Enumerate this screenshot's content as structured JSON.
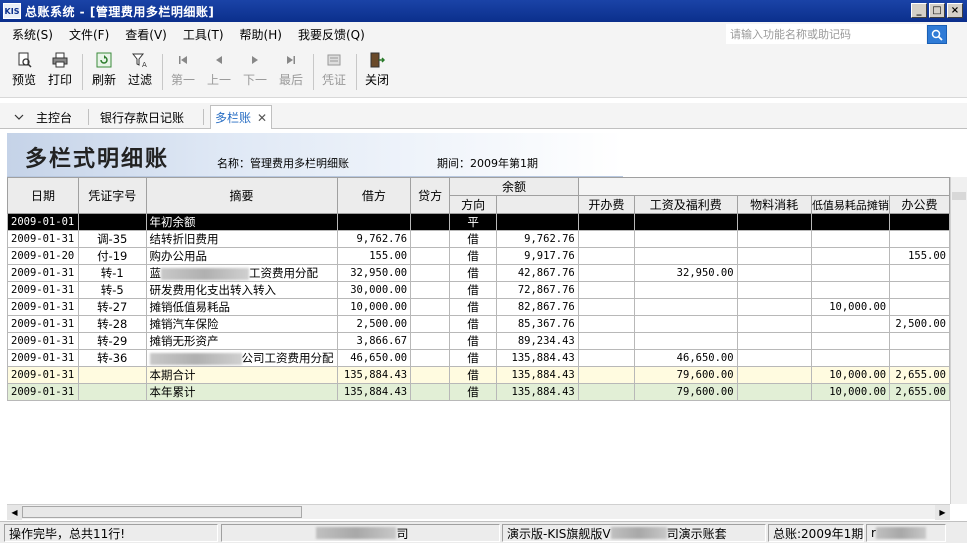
{
  "window": {
    "logo": "KIS",
    "title": "总账系统 - [管理费用多栏明细账]"
  },
  "menu": {
    "items": [
      "系统(S)",
      "文件(F)",
      "查看(V)",
      "工具(T)",
      "帮助(H)",
      "我要反馈(Q)"
    ],
    "search_placeholder": "请输入功能名称或助记码"
  },
  "toolbar": {
    "preview": "预览",
    "print": "打印",
    "refresh": "刷新",
    "filter": "过滤",
    "first": "第一",
    "prev": "上一",
    "next": "下一",
    "last": "最后",
    "voucher": "凭证",
    "close": "关闭"
  },
  "tabs": [
    {
      "label": "主控台"
    },
    {
      "label": "银行存款日记账"
    },
    {
      "label": "多栏账"
    }
  ],
  "report": {
    "title": "多栏式明细账",
    "name": "名称：管理费用多栏明细账",
    "period": "期间：2009年第1期"
  },
  "grid": {
    "headers": {
      "date": "日期",
      "voucher": "凭证字号",
      "summary": "摘要",
      "debit": "借方",
      "credit": "贷方",
      "balance": "余额",
      "direction": "方向",
      "amount": "",
      "c1": "开办费",
      "c2": "工资及福利费",
      "c3": "物料消耗",
      "c4": "低值易耗品摊销",
      "c5": "办公费"
    },
    "rows": [
      {
        "date": "2009-01-01",
        "voucher": "",
        "summary": "年初余额",
        "debit": "",
        "credit": "",
        "dir": "平",
        "bal": "",
        "c1": "",
        "c2": "",
        "c3": "",
        "c4": "",
        "c5": ""
      },
      {
        "date": "2009-01-31",
        "voucher": "调-35",
        "summary": "结转折旧费用",
        "debit": "9,762.76",
        "credit": "",
        "dir": "借",
        "bal": "9,762.76",
        "c1": "",
        "c2": "",
        "c3": "",
        "c4": "",
        "c5": ""
      },
      {
        "date": "2009-01-20",
        "voucher": "付-19",
        "summary": "购办公用品",
        "debit": "155.00",
        "credit": "",
        "dir": "借",
        "bal": "9,917.76",
        "c1": "",
        "c2": "",
        "c3": "",
        "c4": "",
        "c5": "155.00"
      },
      {
        "date": "2009-01-31",
        "voucher": "转-1",
        "summary_pre": "蓝",
        "summary": "工资费用分配",
        "debit": "32,950.00",
        "credit": "",
        "dir": "借",
        "bal": "42,867.76",
        "c1": "",
        "c2": "32,950.00",
        "c3": "",
        "c4": "",
        "c5": ""
      },
      {
        "date": "2009-01-31",
        "voucher": "转-5",
        "summary": "研发费用化支出转入转入",
        "debit": "30,000.00",
        "credit": "",
        "dir": "借",
        "bal": "72,867.76",
        "c1": "",
        "c2": "",
        "c3": "",
        "c4": "",
        "c5": ""
      },
      {
        "date": "2009-01-31",
        "voucher": "转-27",
        "summary": "摊销低值易耗品",
        "debit": "10,000.00",
        "credit": "",
        "dir": "借",
        "bal": "82,867.76",
        "c1": "",
        "c2": "",
        "c3": "",
        "c4": "10,000.00",
        "c5": ""
      },
      {
        "date": "2009-01-31",
        "voucher": "转-28",
        "summary": "摊销汽车保险",
        "debit": "2,500.00",
        "credit": "",
        "dir": "借",
        "bal": "85,367.76",
        "c1": "",
        "c2": "",
        "c3": "",
        "c4": "",
        "c5": "2,500.00"
      },
      {
        "date": "2009-01-31",
        "voucher": "转-29",
        "summary": "摊销无形资产",
        "debit": "3,866.67",
        "credit": "",
        "dir": "借",
        "bal": "89,234.43",
        "c1": "",
        "c2": "",
        "c3": "",
        "c4": "",
        "c5": ""
      },
      {
        "date": "2009-01-31",
        "voucher": "转-36",
        "summary_pre": "",
        "summary": "公司工资费用分配",
        "debit": "46,650.00",
        "credit": "",
        "dir": "借",
        "bal": "135,884.43",
        "c1": "",
        "c2": "46,650.00",
        "c3": "",
        "c4": "",
        "c5": ""
      },
      {
        "date": "2009-01-31",
        "voucher": "",
        "summary": "本期合计",
        "debit": "135,884.43",
        "credit": "",
        "dir": "借",
        "bal": "135,884.43",
        "c1": "",
        "c2": "79,600.00",
        "c3": "",
        "c4": "10,000.00",
        "c5": "2,655.00"
      },
      {
        "date": "2009-01-31",
        "voucher": "",
        "summary": "本年累计",
        "debit": "135,884.43",
        "credit": "",
        "dir": "借",
        "bal": "135,884.43",
        "c1": "",
        "c2": "79,600.00",
        "c3": "",
        "c4": "10,000.00",
        "c5": "2,655.00"
      }
    ]
  },
  "status": {
    "message": "操作完毕，总共11行!",
    "company_suffix": "司",
    "edition": "演示版-KIS旗舰版V",
    "edition_suffix": "司演示账套",
    "period": "总账:2009年1期",
    "tail": "r"
  },
  "colors": {
    "title_bar": "#0b2f8c",
    "selected_row": "#000000",
    "period_total": "#fffbe0",
    "year_total": "#e2efd6",
    "active_tab_text": "#2a6fc4"
  }
}
